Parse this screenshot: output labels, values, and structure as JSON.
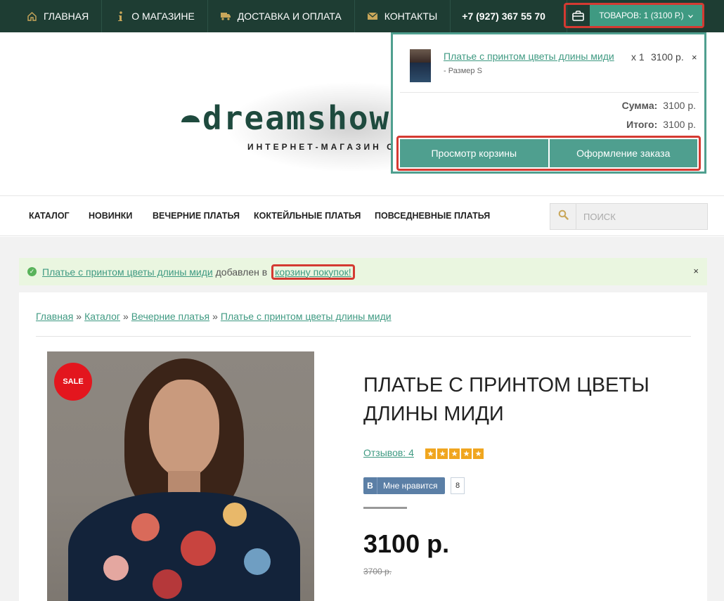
{
  "topbar": {
    "nav": [
      {
        "label": "ГЛАВНАЯ",
        "icon": "home-icon"
      },
      {
        "label": "О МАГАЗИНЕ",
        "icon": "info-icon"
      },
      {
        "label": "ДОСТАВКА И ОПЛАТА",
        "icon": "truck-icon"
      },
      {
        "label": "КОНТАКТЫ",
        "icon": "envelope-icon"
      }
    ],
    "phone": "+7 (927) 367 55 70",
    "cart_label": "ТОВАРОВ: 1 (3100 Р.)"
  },
  "logo": {
    "text": "dreamshow",
    "subtitle": "ИНТЕРНЕТ-МАГАЗИН СТИЛ"
  },
  "cart_dropdown": {
    "item_name": "Платье с принтом цветы длины миди",
    "item_qty": "x 1",
    "item_price": "3100 р.",
    "item_option": "- Размер S",
    "remove_glyph": "×",
    "sum_label": "Сумма:",
    "sum_value": "3100 р.",
    "total_label": "Итого:",
    "total_value": "3100 р.",
    "view_cart_label": "Просмотр корзины",
    "checkout_label": "Оформление заказа"
  },
  "catnav": {
    "items": [
      "КАТАЛОГ",
      "НОВИНКИ",
      "ВЕЧЕРНИЕ ПЛАТЬЯ",
      "КОКТЕЙЛЬНЫЕ ПЛАТЬЯ",
      "ПОВСЕДНЕВНЫЕ ПЛАТЬЯ"
    ],
    "search_placeholder": "ПОИСК"
  },
  "alert": {
    "product_link": "Платье с принтом цветы длины миди",
    "middle_text": " добавлен в ",
    "cart_link": "корзину покупок!",
    "close_glyph": "×"
  },
  "breadcrumbs": [
    "Главная",
    "Каталог",
    "Вечерние платья",
    "Платье с принтом цветы длины миди"
  ],
  "breadcrumb_separator": "»",
  "product": {
    "sale_badge": "SALE",
    "title": "ПЛАТЬЕ С ПРИНТОМ ЦВЕТЫ ДЛИНЫ МИДИ",
    "reviews": "Отзывов: 4",
    "rating": 5,
    "vk_letter": "В",
    "vk_like": "Мне нравится",
    "vk_count": "8",
    "price": "3100 р.",
    "old_price": "3700 р."
  },
  "colors": {
    "topbar": "#1e3d33",
    "accent": "#3f9a82",
    "highlight": "#d43a32",
    "sale": "#e3161e",
    "star": "#f0a61f"
  }
}
